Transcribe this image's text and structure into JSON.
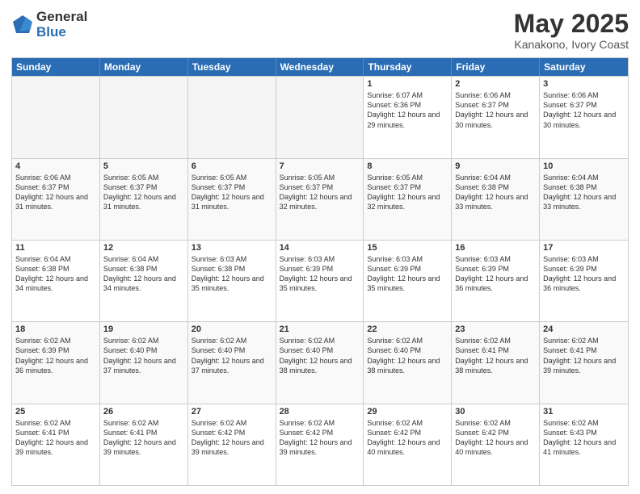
{
  "logo": {
    "general": "General",
    "blue": "Blue"
  },
  "title": {
    "month": "May 2025",
    "location": "Kanakono, Ivory Coast"
  },
  "header_days": [
    "Sunday",
    "Monday",
    "Tuesday",
    "Wednesday",
    "Thursday",
    "Friday",
    "Saturday"
  ],
  "weeks": [
    [
      {
        "day": "",
        "sunrise": "",
        "sunset": "",
        "daylight": "",
        "empty": true
      },
      {
        "day": "",
        "sunrise": "",
        "sunset": "",
        "daylight": "",
        "empty": true
      },
      {
        "day": "",
        "sunrise": "",
        "sunset": "",
        "daylight": "",
        "empty": true
      },
      {
        "day": "",
        "sunrise": "",
        "sunset": "",
        "daylight": "",
        "empty": true
      },
      {
        "day": "1",
        "sunrise": "Sunrise: 6:07 AM",
        "sunset": "Sunset: 6:36 PM",
        "daylight": "Daylight: 12 hours and 29 minutes."
      },
      {
        "day": "2",
        "sunrise": "Sunrise: 6:06 AM",
        "sunset": "Sunset: 6:37 PM",
        "daylight": "Daylight: 12 hours and 30 minutes."
      },
      {
        "day": "3",
        "sunrise": "Sunrise: 6:06 AM",
        "sunset": "Sunset: 6:37 PM",
        "daylight": "Daylight: 12 hours and 30 minutes."
      }
    ],
    [
      {
        "day": "4",
        "sunrise": "Sunrise: 6:06 AM",
        "sunset": "Sunset: 6:37 PM",
        "daylight": "Daylight: 12 hours and 31 minutes."
      },
      {
        "day": "5",
        "sunrise": "Sunrise: 6:05 AM",
        "sunset": "Sunset: 6:37 PM",
        "daylight": "Daylight: 12 hours and 31 minutes."
      },
      {
        "day": "6",
        "sunrise": "Sunrise: 6:05 AM",
        "sunset": "Sunset: 6:37 PM",
        "daylight": "Daylight: 12 hours and 31 minutes."
      },
      {
        "day": "7",
        "sunrise": "Sunrise: 6:05 AM",
        "sunset": "Sunset: 6:37 PM",
        "daylight": "Daylight: 12 hours and 32 minutes."
      },
      {
        "day": "8",
        "sunrise": "Sunrise: 6:05 AM",
        "sunset": "Sunset: 6:37 PM",
        "daylight": "Daylight: 12 hours and 32 minutes."
      },
      {
        "day": "9",
        "sunrise": "Sunrise: 6:04 AM",
        "sunset": "Sunset: 6:38 PM",
        "daylight": "Daylight: 12 hours and 33 minutes."
      },
      {
        "day": "10",
        "sunrise": "Sunrise: 6:04 AM",
        "sunset": "Sunset: 6:38 PM",
        "daylight": "Daylight: 12 hours and 33 minutes."
      }
    ],
    [
      {
        "day": "11",
        "sunrise": "Sunrise: 6:04 AM",
        "sunset": "Sunset: 6:38 PM",
        "daylight": "Daylight: 12 hours and 34 minutes."
      },
      {
        "day": "12",
        "sunrise": "Sunrise: 6:04 AM",
        "sunset": "Sunset: 6:38 PM",
        "daylight": "Daylight: 12 hours and 34 minutes."
      },
      {
        "day": "13",
        "sunrise": "Sunrise: 6:03 AM",
        "sunset": "Sunset: 6:38 PM",
        "daylight": "Daylight: 12 hours and 35 minutes."
      },
      {
        "day": "14",
        "sunrise": "Sunrise: 6:03 AM",
        "sunset": "Sunset: 6:39 PM",
        "daylight": "Daylight: 12 hours and 35 minutes."
      },
      {
        "day": "15",
        "sunrise": "Sunrise: 6:03 AM",
        "sunset": "Sunset: 6:39 PM",
        "daylight": "Daylight: 12 hours and 35 minutes."
      },
      {
        "day": "16",
        "sunrise": "Sunrise: 6:03 AM",
        "sunset": "Sunset: 6:39 PM",
        "daylight": "Daylight: 12 hours and 36 minutes."
      },
      {
        "day": "17",
        "sunrise": "Sunrise: 6:03 AM",
        "sunset": "Sunset: 6:39 PM",
        "daylight": "Daylight: 12 hours and 36 minutes."
      }
    ],
    [
      {
        "day": "18",
        "sunrise": "Sunrise: 6:02 AM",
        "sunset": "Sunset: 6:39 PM",
        "daylight": "Daylight: 12 hours and 36 minutes."
      },
      {
        "day": "19",
        "sunrise": "Sunrise: 6:02 AM",
        "sunset": "Sunset: 6:40 PM",
        "daylight": "Daylight: 12 hours and 37 minutes."
      },
      {
        "day": "20",
        "sunrise": "Sunrise: 6:02 AM",
        "sunset": "Sunset: 6:40 PM",
        "daylight": "Daylight: 12 hours and 37 minutes."
      },
      {
        "day": "21",
        "sunrise": "Sunrise: 6:02 AM",
        "sunset": "Sunset: 6:40 PM",
        "daylight": "Daylight: 12 hours and 38 minutes."
      },
      {
        "day": "22",
        "sunrise": "Sunrise: 6:02 AM",
        "sunset": "Sunset: 6:40 PM",
        "daylight": "Daylight: 12 hours and 38 minutes."
      },
      {
        "day": "23",
        "sunrise": "Sunrise: 6:02 AM",
        "sunset": "Sunset: 6:41 PM",
        "daylight": "Daylight: 12 hours and 38 minutes."
      },
      {
        "day": "24",
        "sunrise": "Sunrise: 6:02 AM",
        "sunset": "Sunset: 6:41 PM",
        "daylight": "Daylight: 12 hours and 39 minutes."
      }
    ],
    [
      {
        "day": "25",
        "sunrise": "Sunrise: 6:02 AM",
        "sunset": "Sunset: 6:41 PM",
        "daylight": "Daylight: 12 hours and 39 minutes."
      },
      {
        "day": "26",
        "sunrise": "Sunrise: 6:02 AM",
        "sunset": "Sunset: 6:41 PM",
        "daylight": "Daylight: 12 hours and 39 minutes."
      },
      {
        "day": "27",
        "sunrise": "Sunrise: 6:02 AM",
        "sunset": "Sunset: 6:42 PM",
        "daylight": "Daylight: 12 hours and 39 minutes."
      },
      {
        "day": "28",
        "sunrise": "Sunrise: 6:02 AM",
        "sunset": "Sunset: 6:42 PM",
        "daylight": "Daylight: 12 hours and 39 minutes."
      },
      {
        "day": "29",
        "sunrise": "Sunrise: 6:02 AM",
        "sunset": "Sunset: 6:42 PM",
        "daylight": "Daylight: 12 hours and 40 minutes."
      },
      {
        "day": "30",
        "sunrise": "Sunrise: 6:02 AM",
        "sunset": "Sunset: 6:42 PM",
        "daylight": "Daylight: 12 hours and 40 minutes."
      },
      {
        "day": "31",
        "sunrise": "Sunrise: 6:02 AM",
        "sunset": "Sunset: 6:43 PM",
        "daylight": "Daylight: 12 hours and 41 minutes."
      }
    ]
  ]
}
